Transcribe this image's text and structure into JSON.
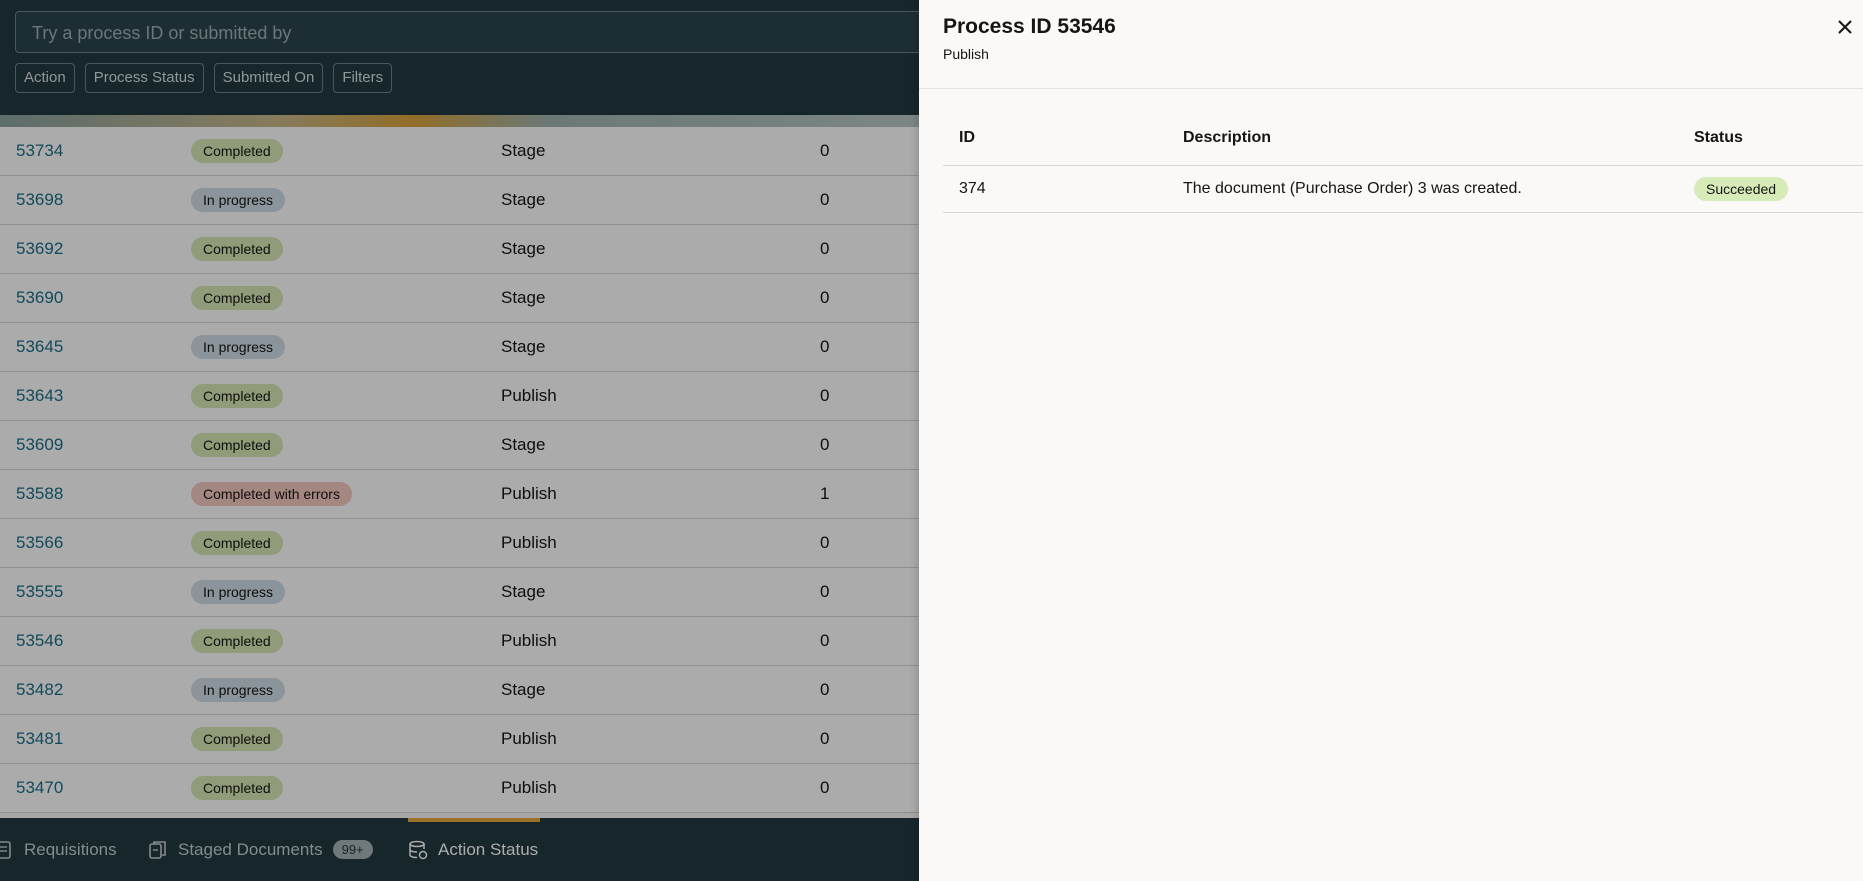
{
  "search": {
    "placeholder": "Try a process ID or submitted by"
  },
  "filters": [
    "Action",
    "Process Status",
    "Submitted On",
    "Filters"
  ],
  "rows": [
    {
      "id": "53734",
      "status": "Completed",
      "action": "Stage",
      "count": "0"
    },
    {
      "id": "53698",
      "status": "In progress",
      "action": "Stage",
      "count": "0"
    },
    {
      "id": "53692",
      "status": "Completed",
      "action": "Stage",
      "count": "0"
    },
    {
      "id": "53690",
      "status": "Completed",
      "action": "Stage",
      "count": "0"
    },
    {
      "id": "53645",
      "status": "In progress",
      "action": "Stage",
      "count": "0"
    },
    {
      "id": "53643",
      "status": "Completed",
      "action": "Publish",
      "count": "0"
    },
    {
      "id": "53609",
      "status": "Completed",
      "action": "Stage",
      "count": "0"
    },
    {
      "id": "53588",
      "status": "Completed with errors",
      "action": "Publish",
      "count": "1"
    },
    {
      "id": "53566",
      "status": "Completed",
      "action": "Publish",
      "count": "0"
    },
    {
      "id": "53555",
      "status": "In progress",
      "action": "Stage",
      "count": "0"
    },
    {
      "id": "53546",
      "status": "Completed",
      "action": "Publish",
      "count": "0"
    },
    {
      "id": "53482",
      "status": "In progress",
      "action": "Stage",
      "count": "0"
    },
    {
      "id": "53481",
      "status": "Completed",
      "action": "Publish",
      "count": "0"
    },
    {
      "id": "53470",
      "status": "Completed",
      "action": "Publish",
      "count": "0"
    }
  ],
  "footer": {
    "tabs": [
      {
        "label": "Requisitions",
        "icon": "document-icon"
      },
      {
        "label": "Staged Documents",
        "icon": "documents-icon",
        "badge": "99+"
      },
      {
        "label": "Action Status",
        "icon": "database-status-icon",
        "active": true
      }
    ]
  },
  "drawer": {
    "title": "Process ID 53546",
    "subtitle": "Publish",
    "columns": [
      "ID",
      "Description",
      "Status"
    ],
    "rows": [
      {
        "id": "374",
        "description": "The document (Purchase Order) 3 was created.",
        "status": "Succeeded"
      }
    ]
  }
}
